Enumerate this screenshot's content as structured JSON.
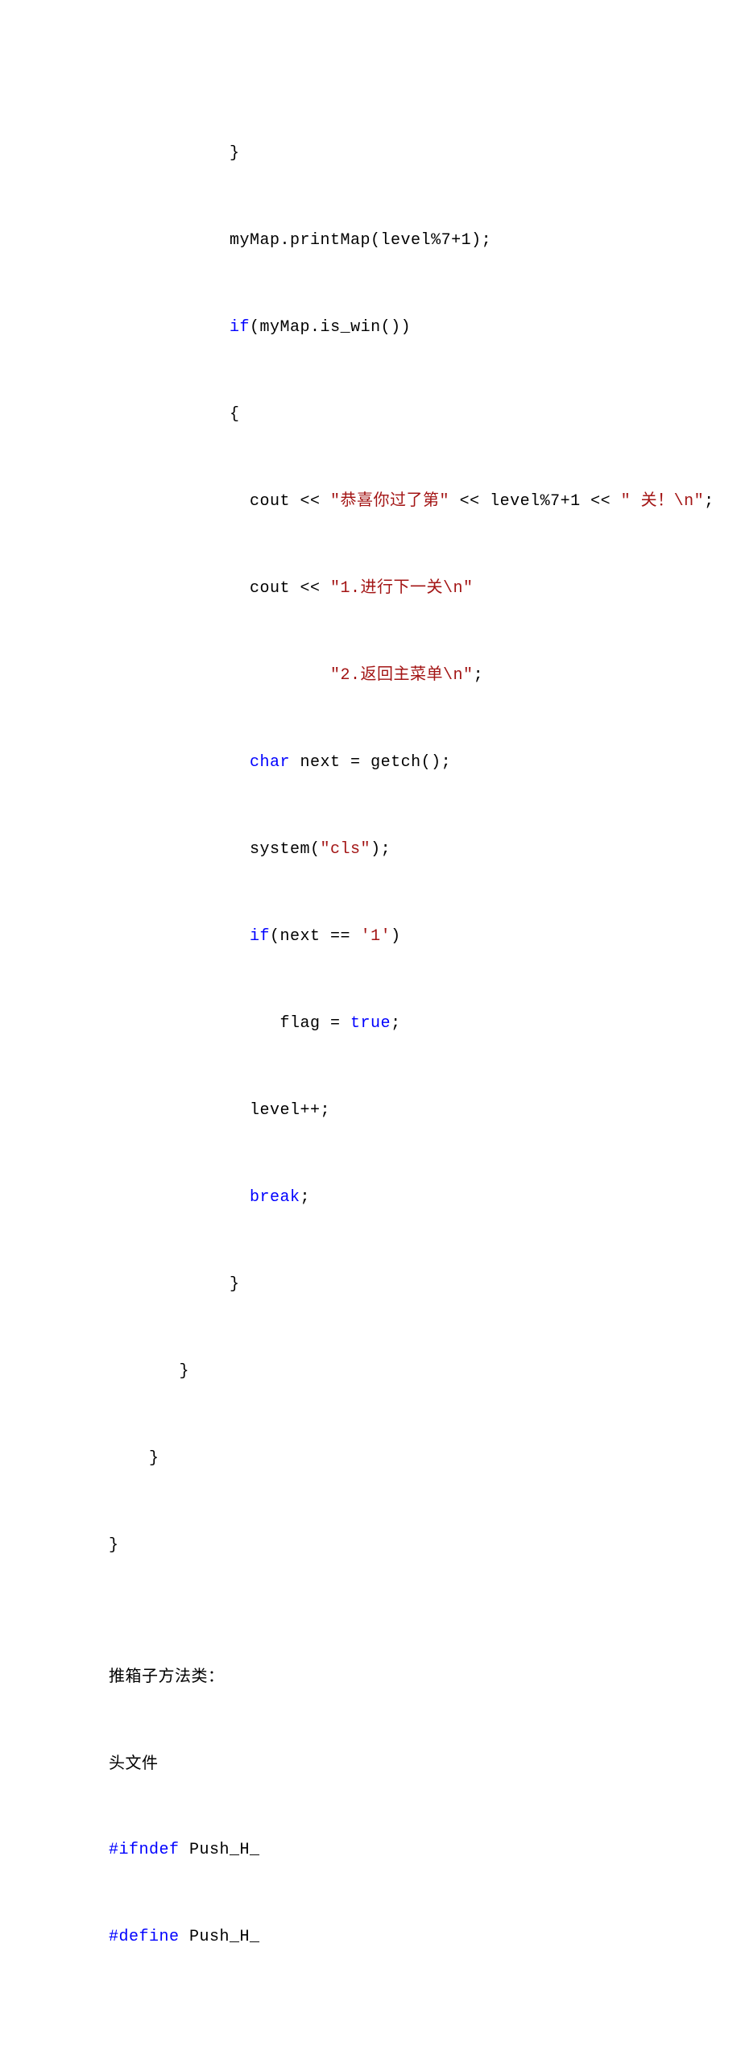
{
  "code": {
    "l1": "            }",
    "l2": "            myMap.printMap(level%7+1);",
    "l3a": "            ",
    "l3b": "if",
    "l3c": "(myMap.is_win())",
    "l4": "            {",
    "l5a": "              cout << ",
    "l5b": "\"恭喜你过了第\"",
    "l5c": " << level%7+1 << ",
    "l5d": "\" 关！\\n\"",
    "l5e": ";",
    "l6a": "              cout << ",
    "l6b": "\"1.进行下一关\\n\"",
    "l7": "                      \"2.返回主菜单\\n\"",
    "l7b": ";",
    "l8a": "              ",
    "l8b": "char",
    "l8c": " next = getch();",
    "l9a": "              system(",
    "l9b": "\"cls\"",
    "l9c": ");",
    "l10a": "              ",
    "l10b": "if",
    "l10c": "(next == ",
    "l10d": "'1'",
    "l10e": ")",
    "l11a": "                 flag = ",
    "l11b": "true",
    "l11c": ";",
    "l12": "              level++;",
    "l13a": "              ",
    "l13b": "break",
    "l13c": ";",
    "l14": "            }",
    "l15": "       }",
    "l16": "    }",
    "l17": "}",
    "l18": "",
    "p1": "推箱子方法类：",
    "p2": "头文件",
    "l19a": "#ifndef",
    "l19b": " Push_H_",
    "l20a": "#define",
    "l20b": " Push_H_"
  }
}
